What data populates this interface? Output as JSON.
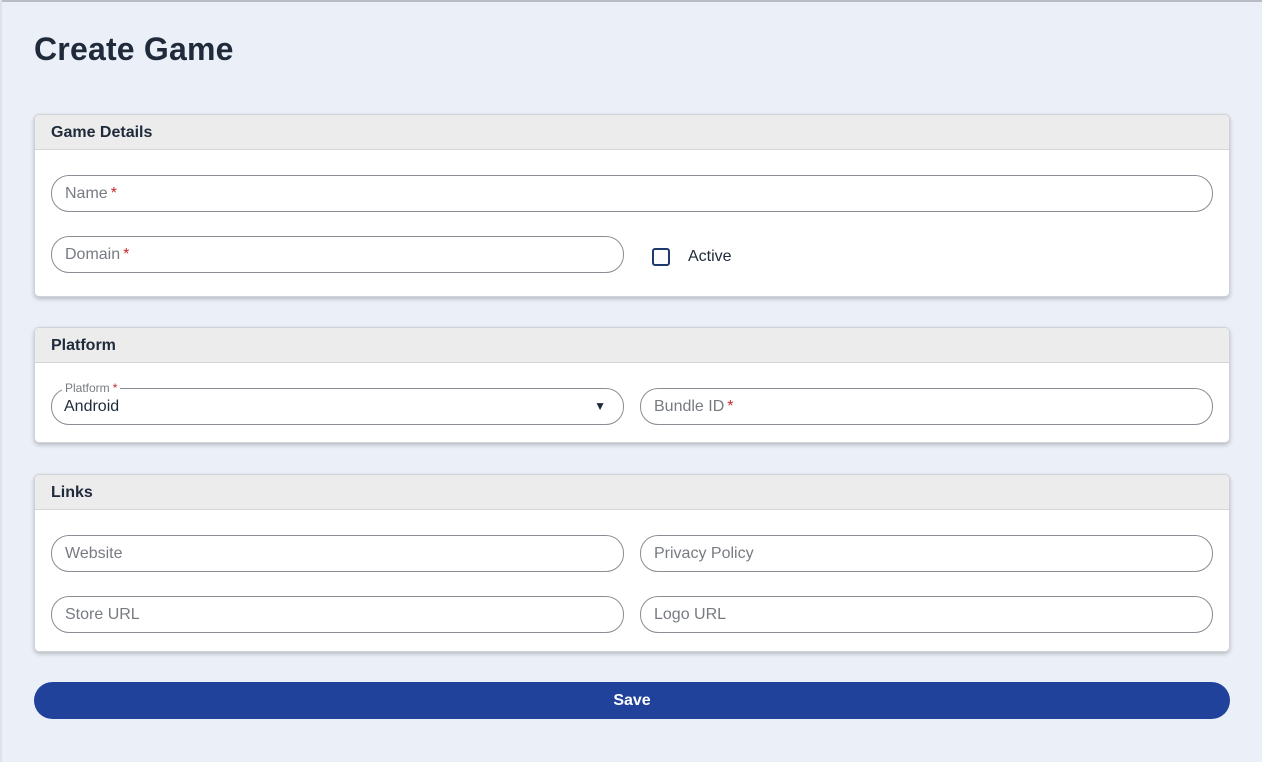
{
  "page": {
    "title": "Create Game"
  },
  "game_details": {
    "header": "Game Details",
    "name_placeholder": "Name",
    "domain_placeholder": "Domain",
    "required_mark": "*",
    "active_label": "Active",
    "active_checked": false
  },
  "platform": {
    "header": "Platform",
    "select_label": "Platform",
    "select_value": "Android",
    "select_arrow": "▼",
    "bundle_placeholder": "Bundle ID"
  },
  "links": {
    "header": "Links",
    "website_placeholder": "Website",
    "privacy_placeholder": "Privacy Policy",
    "store_placeholder": "Store URL",
    "logo_placeholder": "Logo URL"
  },
  "actions": {
    "save_label": "Save"
  },
  "colors": {
    "background": "#ebeff7",
    "primary": "#21429b",
    "required": "#c62828",
    "text": "#1f2a3a"
  }
}
